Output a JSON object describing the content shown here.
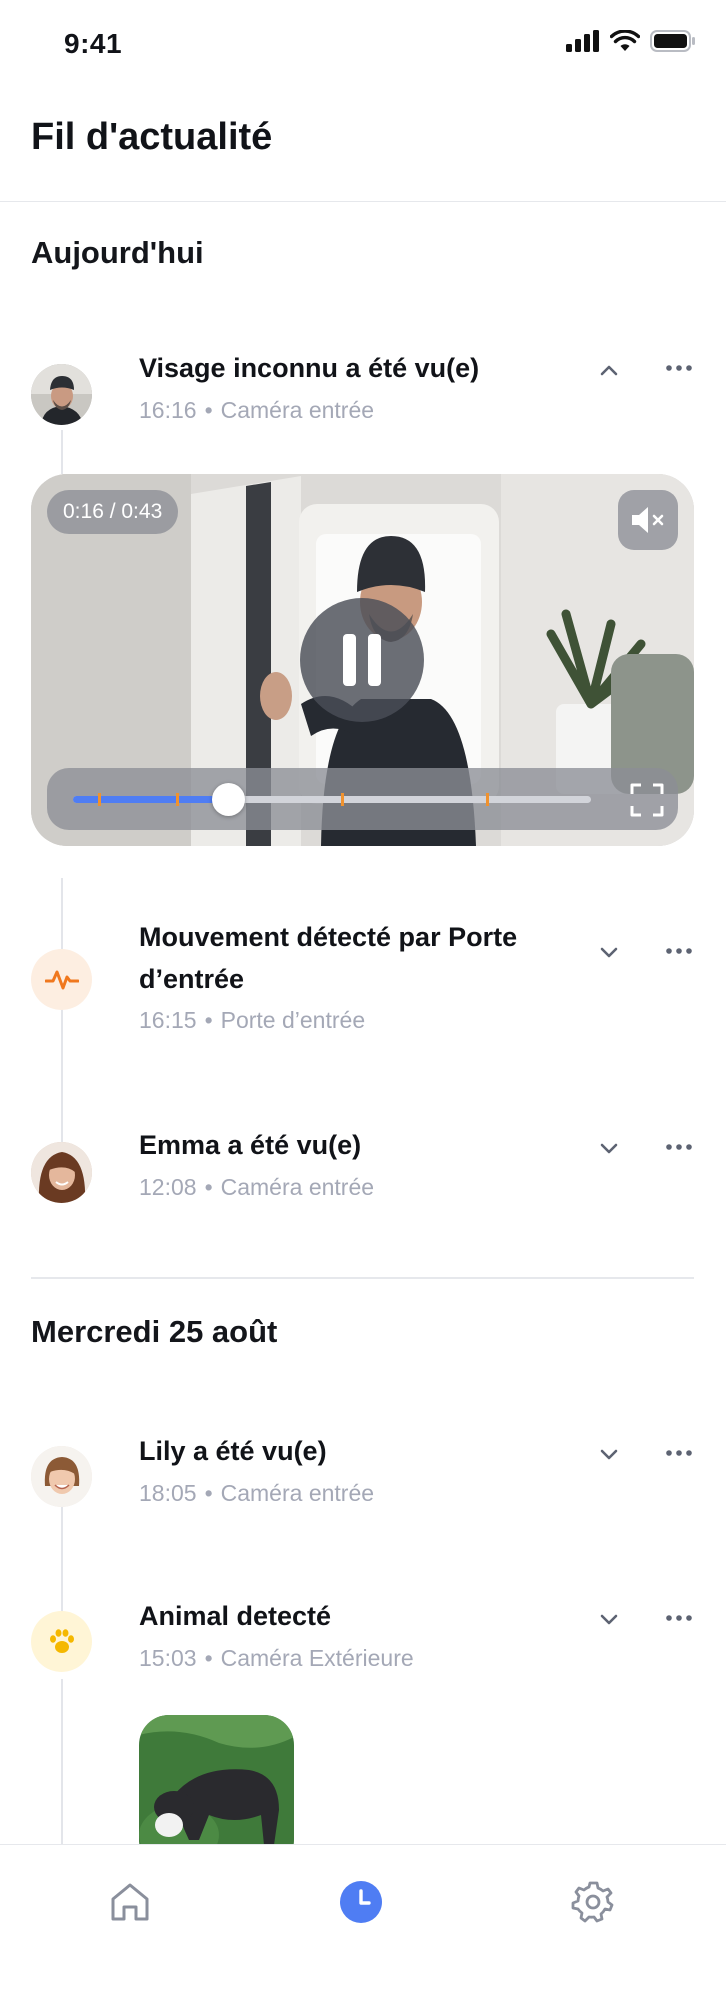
{
  "status_bar": {
    "time": "9:41",
    "icons": [
      "cellular-signal-icon",
      "wifi-icon",
      "battery-icon"
    ]
  },
  "header": {
    "title": "Fil d'actualité"
  },
  "sections": [
    {
      "title": "Aujourd'hui",
      "events": [
        {
          "title": "Visage inconnu a été vu(e)",
          "time": "16:16",
          "source": "Caméra entrée",
          "icon": "unknown-face-avatar",
          "expanded": true,
          "video": {
            "elapsed_label": "0:16 / 0:43",
            "progress": 0.3,
            "event_markers": [
              0.05,
              0.2,
              0.52,
              0.8
            ],
            "muted": true,
            "playing": true
          }
        },
        {
          "title": "Mouvement détecté par Porte d’entrée",
          "time": "16:15",
          "source": "Porte d’entrée",
          "icon": "motion-icon",
          "expanded": false
        },
        {
          "title": "Emma a été vu(e)",
          "time": "12:08",
          "source": "Caméra entrée",
          "icon": "emma-avatar",
          "expanded": false
        }
      ]
    },
    {
      "title": "Mercredi 25 août",
      "events": [
        {
          "title": "Lily a été vu(e)",
          "time": "18:05",
          "source": "Caméra entrée",
          "icon": "lily-avatar",
          "expanded": false
        },
        {
          "title": "Animal detecté",
          "time": "15:03",
          "source": "Caméra Extérieure",
          "icon": "paw-icon",
          "expanded": false,
          "thumbnail": "dog-thumbnail"
        }
      ]
    }
  ],
  "tab_bar": {
    "tabs": [
      "home-icon",
      "clock-icon",
      "gear-icon"
    ],
    "active_tab": "clock-icon"
  },
  "colors": {
    "accent": "#4f7df3",
    "marker": "#f0922e",
    "muted_text": "#a4a8b6",
    "motion_bg": "#fdeee1",
    "paw_bg": "#fff5d6"
  }
}
